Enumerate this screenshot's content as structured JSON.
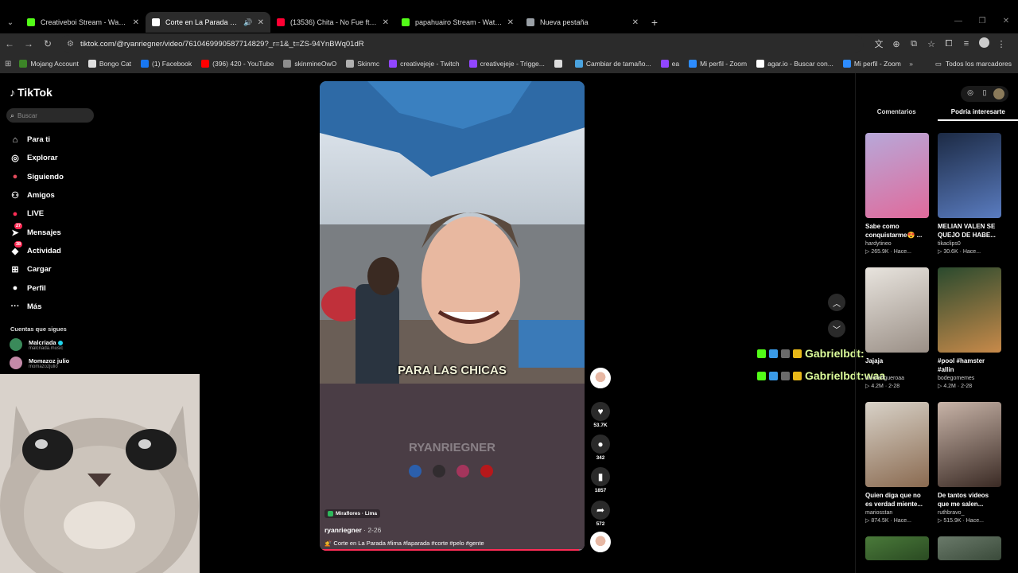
{
  "browser": {
    "tabs": [
      {
        "title": "Creativeboi Stream - Watch Live",
        "color": "#53fc18",
        "active": false
      },
      {
        "title": "Corte en La Parada #lima",
        "color": "#ffffff",
        "active": true
      },
      {
        "title": "(13536) Chita - No Fue ft. CA7R",
        "color": "#ff0033",
        "active": false
      },
      {
        "title": "papahuairo Stream - Watch Live",
        "color": "#53fc18",
        "active": false
      },
      {
        "title": "Nueva pestaña",
        "color": "#9aa0a6",
        "active": false
      }
    ],
    "url": "tiktok.com/@ryanriegner/video/7610469990587714829?_r=1&_t=ZS-94YnBWq01dR",
    "bookmarks": [
      {
        "label": "Mojang Account",
        "color": "#3c8527"
      },
      {
        "label": "Bongo Cat",
        "color": "#e0e0e0"
      },
      {
        "label": "(1) Facebook",
        "color": "#1877f2"
      },
      {
        "label": "(396) 420 - YouTube",
        "color": "#ff0000"
      },
      {
        "label": "skinmineOwO",
        "color": "#8d8d8d"
      },
      {
        "label": "Skinmc",
        "color": "#b0b0b0"
      },
      {
        "label": "creativejeje - Twitch",
        "color": "#9146ff"
      },
      {
        "label": "creativejeje - Trigge...",
        "color": "#9146ff"
      },
      {
        "label": "",
        "color": "#dddddd"
      },
      {
        "label": "Cambiar de tamaño...",
        "color": "#4aa3df"
      },
      {
        "label": "ea",
        "color": "#9146ff"
      },
      {
        "label": "Mi perfil - Zoom",
        "color": "#2d8cff"
      },
      {
        "label": "agar.io - Buscar con...",
        "color": "#ffffff"
      },
      {
        "label": "Mi perfil - Zoom",
        "color": "#2d8cff"
      }
    ],
    "all_bookmarks": "Todos los marcadores"
  },
  "tiktok": {
    "logo": "TikTok",
    "search_placeholder": "Buscar",
    "nav": [
      {
        "label": "Para ti",
        "icon": "home-icon",
        "glyph": "⌂"
      },
      {
        "label": "Explorar",
        "icon": "compass-icon",
        "glyph": "◎"
      },
      {
        "label": "Siguiendo",
        "icon": "following-icon",
        "glyph": "●"
      },
      {
        "label": "Amigos",
        "icon": "friends-icon",
        "glyph": "⚇"
      },
      {
        "label": "LIVE",
        "icon": "live-icon",
        "glyph": "●"
      },
      {
        "label": "Mensajes",
        "icon": "messages-icon",
        "glyph": "➤",
        "badge": "27"
      },
      {
        "label": "Actividad",
        "icon": "activity-icon",
        "glyph": "◆",
        "badge": "38"
      },
      {
        "label": "Cargar",
        "icon": "upload-icon",
        "glyph": "⊞"
      },
      {
        "label": "Perfil",
        "icon": "profile-icon",
        "glyph": "●"
      },
      {
        "label": "Más",
        "icon": "more-icon",
        "glyph": "···"
      }
    ],
    "following_title": "Cuentas que sigues",
    "following": [
      {
        "name": "Malcriada",
        "handle": "malcriada.music",
        "verified": true,
        "color": "#3a8a5a"
      },
      {
        "name": "Momazoz julio",
        "handle": "momazozjulio",
        "verified": false,
        "color": "#c48aa8"
      }
    ]
  },
  "video": {
    "caption": "PARA LAS CHICAS",
    "watermark": "RYANRIEGNER",
    "location": "Miraflores · Lima",
    "author": "ryanriegner",
    "date": " · 2-26",
    "description": "💇 Corte en La Parada #lima #laparada #corte #pelo #gente",
    "progress": 0.98,
    "likes": "53.7K",
    "comments": "342",
    "saves": "1857",
    "shares": "572"
  },
  "chat": [
    {
      "user": "Gabrielbdt",
      "message": ""
    },
    {
      "user": "Gabrielbdt",
      "message": "waa"
    }
  ],
  "right_panel": {
    "tabs": [
      {
        "label": "Comentarios",
        "active": false
      },
      {
        "label": "Podría interesarte",
        "active": true
      }
    ],
    "cards": [
      {
        "title": "Sabe como conquistarme😍 ...",
        "user": "hardytineo",
        "views": "265.9K",
        "time": "Hace...",
        "c1": "#b7a8d9",
        "c2": "#e06a9b"
      },
      {
        "title": "MELIAN VALEN SE QUEJO DE HABE...",
        "user": "tikaclips0",
        "views": "30.6K",
        "time": "Hace...",
        "c1": "#1c2a44",
        "c2": "#5a7cc0"
      },
      {
        "title": "Jajaja",
        "user": "nicollefigueroaa",
        "views": "4.2M",
        "time": "2-28",
        "c1": "#e8e4de",
        "c2": "#9a8f86"
      },
      {
        "title": "#pool #hamster #allin",
        "user": "bodegomemes",
        "views": "4.2M",
        "time": "2-28",
        "c1": "#2a4a2e",
        "c2": "#c88a4a"
      },
      {
        "title": "Quien diga que no es verdad miente...",
        "user": "mariosstan",
        "views": "874.5K",
        "time": "Hace...",
        "c1": "#d8d2c8",
        "c2": "#8a6a50"
      },
      {
        "title": "De tantos videos que me salen...",
        "user": "ruthbravo_",
        "views": "515.9K",
        "time": "Hace...",
        "c1": "#c8b4a8",
        "c2": "#3a2a24"
      },
      {
        "title": "",
        "user": "",
        "views": "",
        "time": "",
        "c1": "#4a7a3a",
        "c2": "#2a4a22"
      },
      {
        "title": "",
        "user": "",
        "views": "",
        "time": "",
        "c1": "#6a7a6a",
        "c2": "#3a4a3a"
      }
    ]
  }
}
